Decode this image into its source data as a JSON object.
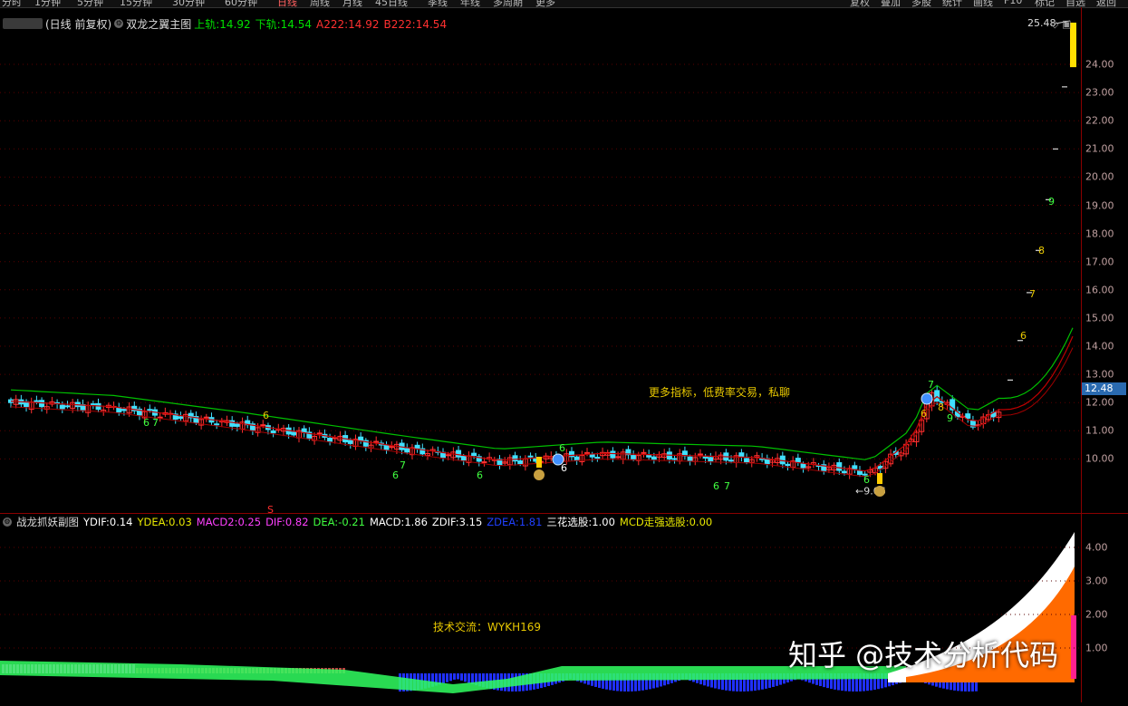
{
  "toolbar": {
    "left_items": [
      "分时",
      "1分钟",
      "5分钟",
      "15分钟",
      "30分钟",
      "60分钟",
      "日线",
      "周线",
      "月线",
      "45日线",
      "季线",
      "年线",
      "多周期",
      "更多"
    ],
    "right_items": [
      "复权",
      "叠加",
      "多股",
      "统计",
      "画线",
      "F10",
      "标记",
      "自选",
      "返回"
    ]
  },
  "main_panel": {
    "period_label": "(日线 前复权)",
    "indicator_name": "双龙之翼主图",
    "values": [
      {
        "label": "上轨:",
        "value": "14.92",
        "color": "#00e000"
      },
      {
        "label": "下轨:",
        "value": "14.54",
        "color": "#00e000"
      },
      {
        "label": "A222:",
        "value": "14.92",
        "color": "#ff3030"
      },
      {
        "label": "B222:",
        "value": "14.54",
        "color": "#ff3030"
      }
    ],
    "high_label": "25.48",
    "low_label": "9.06",
    "current_price": "12.48",
    "annotation": "更多指标，低费率交易，私聊",
    "axis_ticks": [
      "24.00",
      "23.00",
      "22.00",
      "21.00",
      "20.00",
      "19.00",
      "18.00",
      "17.00",
      "16.00",
      "15.00",
      "14.00",
      "13.00",
      "12.00",
      "11.00",
      "10.00"
    ],
    "markers": [
      {
        "text": "6",
        "color": "#e8c800"
      },
      {
        "text": "6",
        "color": "#40ff40"
      },
      {
        "text": "7",
        "color": "#40ff40"
      },
      {
        "text": "7",
        "color": "#40ff40"
      },
      {
        "text": "6",
        "color": "#40ff40"
      },
      {
        "text": "6",
        "color": "#40ff40"
      },
      {
        "text": "6",
        "color": "#40ff40"
      },
      {
        "text": "6",
        "color": "#ffffff"
      },
      {
        "text": "6",
        "color": "#40ff40"
      },
      {
        "text": "7",
        "color": "#40ff40"
      },
      {
        "text": "6",
        "color": "#40ff40"
      },
      {
        "text": "6",
        "color": "#e8c800"
      },
      {
        "text": "8",
        "color": "#e8c800"
      },
      {
        "text": "9",
        "color": "#40ff40"
      },
      {
        "text": "7",
        "color": "#40ff40"
      },
      {
        "text": "6",
        "color": "#e8c800"
      },
      {
        "text": "7",
        "color": "#e8c800"
      },
      {
        "text": "8",
        "color": "#e8c800"
      },
      {
        "text": "9",
        "color": "#40ff40"
      }
    ],
    "s_marker": "S"
  },
  "sub_panel": {
    "indicator_name": "战龙抓妖副图",
    "values": [
      {
        "label": "YDIF:",
        "value": "0.14",
        "color": "#ffffff"
      },
      {
        "label": "YDEA:",
        "value": "0.03",
        "color": "#e8e800"
      },
      {
        "label": "MACD2:",
        "value": "0.25",
        "color": "#ff40ff"
      },
      {
        "label": "DIF:",
        "value": "0.82",
        "color": "#ff40ff"
      },
      {
        "label": "DEA:",
        "value": "-0.21",
        "color": "#40ff40"
      },
      {
        "label": "MACD:",
        "value": "1.86",
        "color": "#ffffff"
      },
      {
        "label": "ZDIF:",
        "value": "3.15",
        "color": "#ffffff"
      },
      {
        "label": "ZDEA:",
        "value": "1.81",
        "color": "#2040ff"
      },
      {
        "label": "三花选股:",
        "value": "1.00",
        "color": "#ffffff"
      },
      {
        "label": "MCD走强选股:",
        "value": "0.00",
        "color": "#e8e800"
      }
    ],
    "annotation": "技术交流：WYKH169",
    "axis_ticks": [
      "4.00",
      "3.00",
      "2.00",
      "1.00"
    ]
  },
  "watermark": "知乎 @技术分析代码",
  "colors": {
    "up": "#ff3030",
    "down": "#40e0ff",
    "band_upper": "#00c000",
    "band_lower": "#c00000",
    "axis": "#8b0000"
  }
}
